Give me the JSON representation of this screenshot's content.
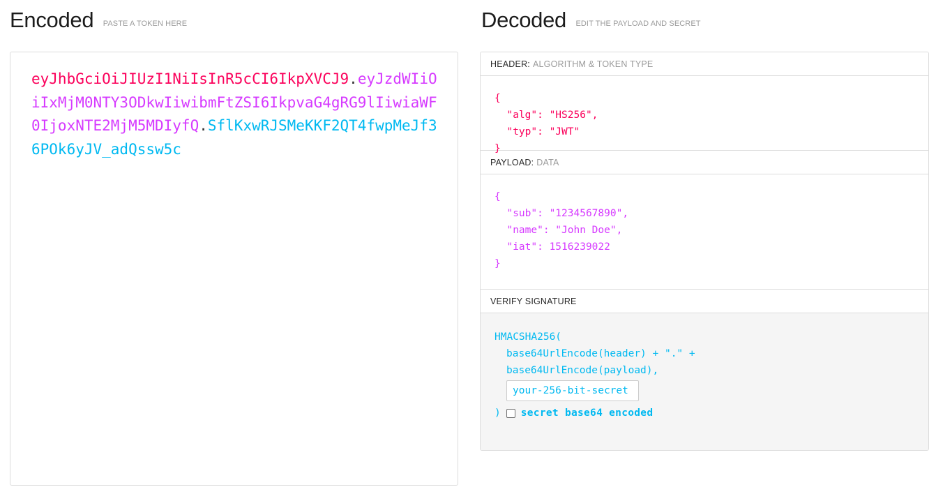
{
  "encoded": {
    "title": "Encoded",
    "subtitle": "PASTE A TOKEN HERE",
    "token": {
      "header_segment": "eyJhbGciOiJIUzI1NiIsInR5cCI6IkpXVCJ9",
      "dot1": ".",
      "payload_segment": "eyJzdWIiOiIxMjM0NTY3ODkwIiwibmFtZSI6IkpvaG4gRG9lIiwiaWF0IjoxNTE2MjM5MDIyfQ",
      "dot2": ".",
      "signature_segment": "SflKxwRJSMeKKF2QT4fwpMeJf36POk6yJV_adQssw5c",
      "full": "eyJhbGciOiJIUzI1NiIsInR5cCI6IkpXVCJ9.eyJzdWIiOiIxMjM0NTY3ODkwIiwibmFtZSI6IkpvaG4gRG9lIiwiaWF0IjoxNTE2MjM5MDIyfQ.SflKxwRJSMeKKF2QT4fwpMeJf36POk6yJV_adQssw5c"
    }
  },
  "decoded": {
    "title": "Decoded",
    "subtitle": "EDIT THE PAYLOAD AND SECRET",
    "sections": {
      "header": {
        "label": "HEADER:",
        "hint": "ALGORITHM & TOKEN TYPE",
        "json": "{\n  \"alg\": \"HS256\",\n  \"typ\": \"JWT\"\n}",
        "fields": {
          "alg": "HS256",
          "typ": "JWT"
        }
      },
      "payload": {
        "label": "PAYLOAD:",
        "hint": "DATA",
        "json": "{\n  \"sub\": \"1234567890\",\n  \"name\": \"John Doe\",\n  \"iat\": 1516239022\n}",
        "fields": {
          "sub": "1234567890",
          "name": "John Doe",
          "iat": "1516239022"
        }
      },
      "signature": {
        "label": "VERIFY SIGNATURE",
        "hint": "",
        "line1": "HMACSHA256(",
        "line2": "base64UrlEncode(header) + \".\" +",
        "line3": "base64UrlEncode(payload),",
        "secret_value": "your-256-bit-secret",
        "secret_placeholder": "your-256-bit-secret",
        "close_paren": ")",
        "base64_label": "secret base64 encoded",
        "base64_checked": false
      }
    }
  },
  "colors": {
    "header_pink": "#fb015b",
    "payload_purple": "#d63aff",
    "signature_blue": "#00b9f1",
    "border_gray": "#dcdcdc",
    "panel_gray": "#f5f5f5",
    "muted_text": "#9a9a9a"
  }
}
